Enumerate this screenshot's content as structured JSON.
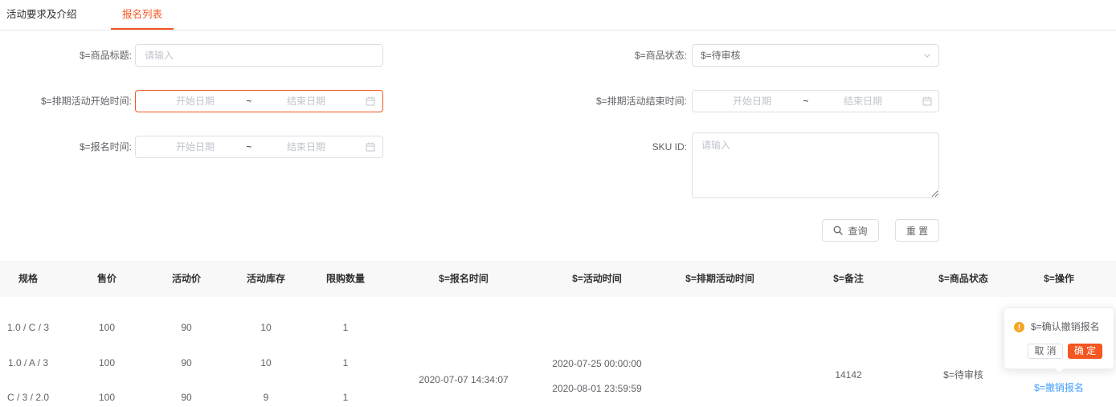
{
  "tabs": [
    {
      "label": "活动要求及介绍",
      "active": false
    },
    {
      "label": "报名列表",
      "active": true
    }
  ],
  "filters": {
    "title": {
      "label": "$=商品标题:",
      "placeholder": "请输入"
    },
    "status": {
      "label": "$=商品状态:",
      "value": "$=待审核",
      "icon": "chevron-down-icon"
    },
    "schedule_start": {
      "label": "$=排期活动开始时间:",
      "start_placeholder": "开始日期",
      "separator": "~",
      "end_placeholder": "结束日期",
      "icon": "calendar-icon",
      "focused": true
    },
    "schedule_end": {
      "label": "$=排期活动结束时间:",
      "start_placeholder": "开始日期",
      "separator": "~",
      "end_placeholder": "结束日期",
      "icon": "calendar-icon"
    },
    "signup_time": {
      "label": "$=报名时间:",
      "start_placeholder": "开始日期",
      "separator": "~",
      "end_placeholder": "结束日期",
      "icon": "calendar-icon"
    },
    "sku_id": {
      "label": "SKU ID:",
      "placeholder": "请输入"
    }
  },
  "buttons": {
    "search": {
      "label": "查询",
      "icon": "search-icon"
    },
    "reset": {
      "label": "重 置"
    }
  },
  "table": {
    "columns": [
      "规格",
      "售价",
      "活动价",
      "活动库存",
      "限购数量",
      "$=报名时间",
      "$=活动时间",
      "$=排期活动时间",
      "$=备注",
      "$=商品状态",
      "$=操作"
    ],
    "rows": [
      {
        "spec": "1.0 / C / 3",
        "price": "100",
        "activity_price": "90",
        "activity_stock": "10",
        "purchase_limit": "1"
      },
      {
        "spec": "1.0 / A / 3",
        "price": "100",
        "activity_price": "90",
        "activity_stock": "10",
        "purchase_limit": "1"
      },
      {
        "spec": "C / 3 / 2.0",
        "price": "100",
        "activity_price": "90",
        "activity_stock": "9",
        "purchase_limit": "1"
      }
    ],
    "signup_time": "2020-07-07 14:34:07",
    "activity_time": [
      "2020-07-25 00:00:00",
      "2020-08-01 23:59:59"
    ],
    "remark": "14142",
    "status": "$=待审核",
    "action": "$=撤销报名"
  },
  "popconfirm": {
    "icon": "warning-icon",
    "message": "$=确认撤销报名",
    "cancel": "取 消",
    "confirm": "确 定"
  },
  "theme": {
    "accent": "#f4561f",
    "link": "#409eff",
    "warning": "#f5a623",
    "header_bg": "#f8f8f9"
  }
}
